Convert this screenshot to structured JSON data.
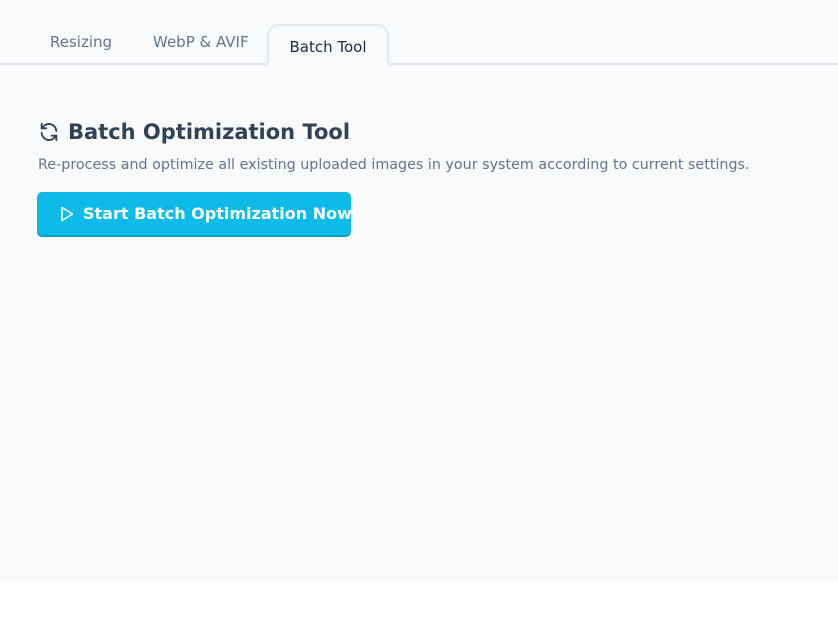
{
  "tabs": [
    {
      "label": "Resizing",
      "active": false
    },
    {
      "label": "WebP & AVIF",
      "active": false
    },
    {
      "label": "Batch Tool",
      "active": true
    }
  ],
  "section": {
    "icon": "refresh-icon",
    "title": "Batch Optimization Tool",
    "description": "Re-process and optimize all existing uploaded images in your system according to current settings."
  },
  "action": {
    "icon": "play-icon",
    "label": "Start Batch Optimization Now"
  },
  "colors": {
    "accent": "#0ebbe8",
    "panel_bg": "#f8fafc",
    "title": "#334155",
    "muted": "#64748b"
  }
}
